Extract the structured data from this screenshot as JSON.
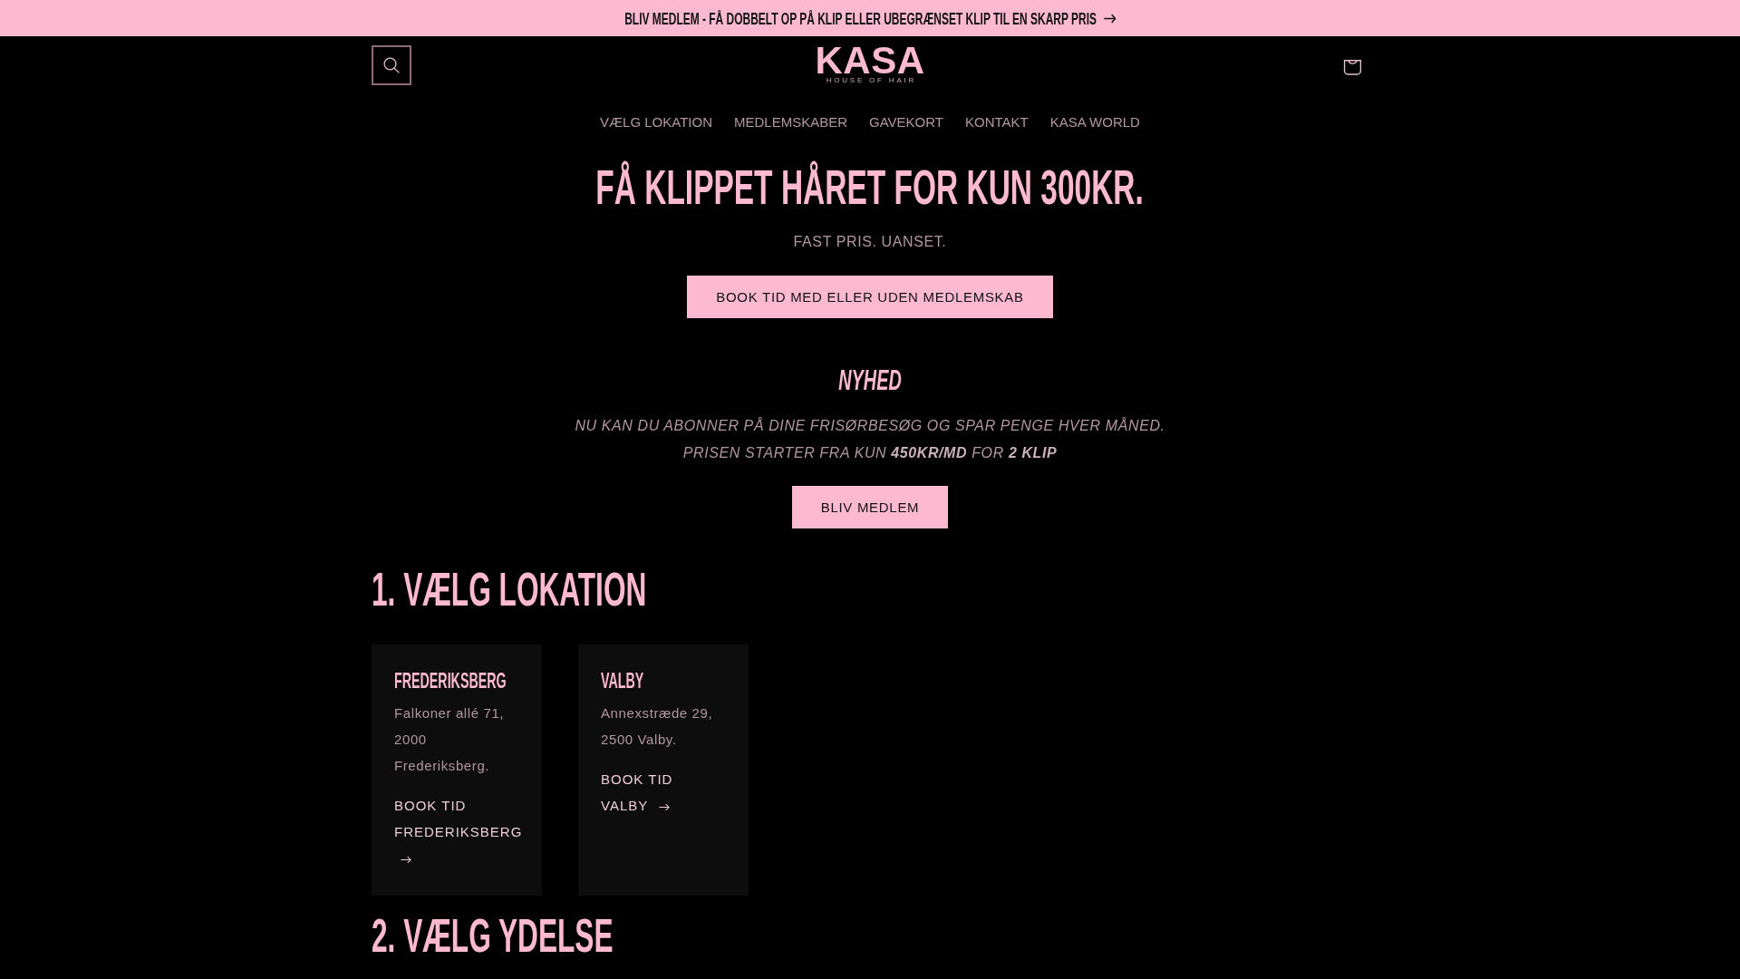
{
  "announcement_bar": {
    "text": "BLIV MEDLEM - FÅ DOBBELT OP PÅ KLIP ELLER UBEGRÆNSET KLIP TIL EN SKARP PRIS"
  },
  "header": {
    "logo": {
      "wordmark": "KASA",
      "tagline": "HOUSE OF HAIR"
    },
    "nav": [
      "VÆLG LOKATION",
      "MEDLEMSKABER",
      "GAVEKORT",
      "KONTAKT",
      "KASA WORLD"
    ]
  },
  "hero": {
    "title": "FÅ KLIPPET HÅRET FOR KUN 300KR.",
    "subtitle": "FAST PRIS. UANSET.",
    "button": "BOOK TID MED ELLER UDEN MEDLEMSKAB"
  },
  "news": {
    "title": "NYHED",
    "lines": [
      "NU KAN DU ABONNER PÅ DINE FRISØRBESØG OG SPAR PENGE HVER MÅNED.",
      "PRISEN STARTER FRA KUN **450KR/MD** FOR **2 KLIP**"
    ],
    "button": "BLIV MEDLEM"
  },
  "locations_section": {
    "heading": "1. VÆLG LOKATION",
    "locations": [
      {
        "name": "FREDERIKSBERG",
        "address": "Falkoner allé 71, 2000 Frederiksberg.",
        "link": "BOOK TID FREDERIKSBERG"
      },
      {
        "name": "VALBY",
        "address": "Annexstræde 29, 2500 Valby.",
        "link": "BOOK TID VALBY"
      }
    ]
  },
  "services_section": {
    "heading": "2. VÆLG YDELSE"
  }
}
